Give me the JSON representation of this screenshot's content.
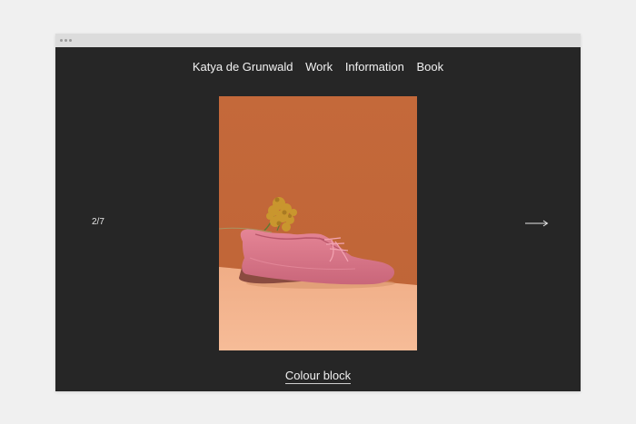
{
  "nav": {
    "site_name": "Katya de Grunwald",
    "items": [
      "Work",
      "Information",
      "Book"
    ]
  },
  "slideshow": {
    "counter": "2/7",
    "caption": "Colour block"
  },
  "icons": {
    "next": "arrow-right-icon"
  },
  "colors": {
    "page_background": "#262626",
    "backdrop_top": "#c46a3a",
    "backdrop_floor": "#f2b48e",
    "shoe": "#d97587",
    "flowers": "#c9962e"
  }
}
